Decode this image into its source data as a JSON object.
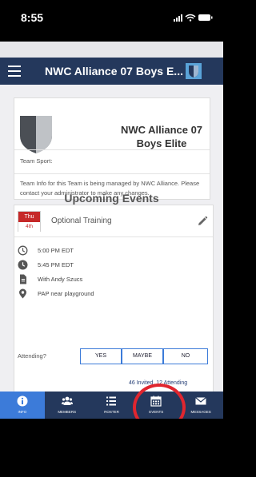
{
  "status_bar": {
    "time": "8:55"
  },
  "header": {
    "title": "NWC Alliance 07 Boys E..."
  },
  "team": {
    "name_line1": "NWC Alliance 07",
    "name_line2": "Boys Elite",
    "sport_label": "Team Sport:",
    "info_text": "Team Info for this Team is being managed by NWC Alliance. Please contact your administrator to make any changes."
  },
  "section_title": "Upcoming Events",
  "event": {
    "day_of_week": "Thu",
    "day": "4th",
    "name": "Optional Training",
    "start_time": "5:00 PM EDT",
    "end_time": "5:45 PM EDT",
    "with": "With Andy Szucs",
    "location": "PAP near playground",
    "attending_label": "Attending?",
    "rsvp_yes": "YES",
    "rsvp_maybe": "MAYBE",
    "rsvp_no": "NO",
    "invite_summary": "46 Invited, 12 Attending"
  },
  "tabs": [
    {
      "label": "INFO",
      "icon": "info-icon",
      "active": true
    },
    {
      "label": "MEMBERS",
      "icon": "members-icon",
      "active": false
    },
    {
      "label": "ROSTER",
      "icon": "roster-icon",
      "active": false
    },
    {
      "label": "EVENTS",
      "icon": "calendar-icon",
      "active": false
    },
    {
      "label": "MESSAGES",
      "icon": "envelope-icon",
      "active": false
    }
  ],
  "colors": {
    "header_bg": "#24385c",
    "active_tab": "#3c7bd9",
    "date_red": "#c62828",
    "highlight_ring": "#e0262f"
  }
}
